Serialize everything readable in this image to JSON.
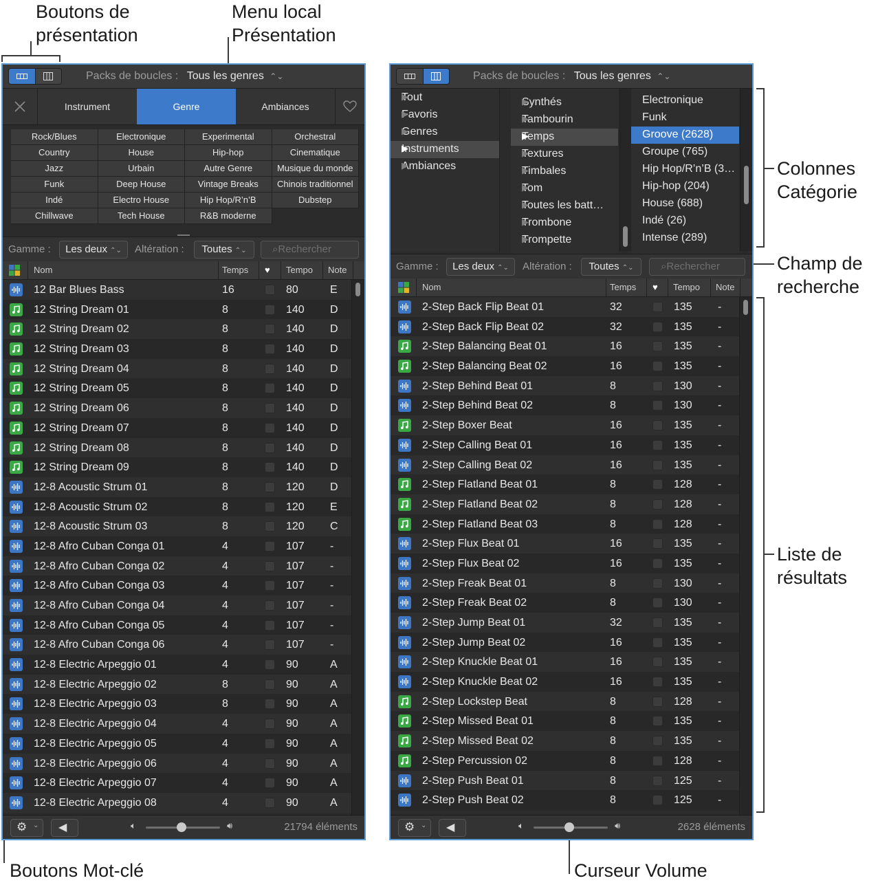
{
  "callouts": {
    "view_buttons": [
      "Boutons de",
      "présentation"
    ],
    "view_menu": [
      "Menu local",
      "Présentation"
    ],
    "category_columns": [
      "Colonnes",
      "Catégorie"
    ],
    "search_field": [
      "Champ de",
      "recherche"
    ],
    "results_list": [
      "Liste de",
      "résultats"
    ],
    "keyword_buttons": "Boutons Mot-clé",
    "volume_slider": "Curseur Volume"
  },
  "header": {
    "packs_label": "Packs de boucles :",
    "packs_value": "Tous les genres"
  },
  "left": {
    "tabs": [
      "Instrument",
      "Genre",
      "Ambiances"
    ],
    "keywords": [
      "Rock/Blues",
      "Electronique",
      "Experimental",
      "Orchestral",
      "Country",
      "House",
      "Hip-hop",
      "Cinematique",
      "Jazz",
      "Urbain",
      "Autre Genre",
      "Musique du monde",
      "Funk",
      "Deep House",
      "Vintage Breaks",
      "Chinois traditionnel",
      "Indé",
      "Electro House",
      "Hip Hop/R’n’B",
      "Dubstep",
      "Chillwave",
      "Tech House",
      "R&B moderne"
    ],
    "count": "21794 éléments",
    "rows": [
      [
        "a",
        "12 Bar Blues Bass",
        "16",
        "80",
        "E"
      ],
      [
        "m",
        "12 String Dream 01",
        "8",
        "140",
        "D"
      ],
      [
        "m",
        "12 String Dream 02",
        "8",
        "140",
        "D"
      ],
      [
        "m",
        "12 String Dream 03",
        "8",
        "140",
        "D"
      ],
      [
        "m",
        "12 String Dream 04",
        "8",
        "140",
        "D"
      ],
      [
        "m",
        "12 String Dream 05",
        "8",
        "140",
        "D"
      ],
      [
        "m",
        "12 String Dream 06",
        "8",
        "140",
        "D"
      ],
      [
        "m",
        "12 String Dream 07",
        "8",
        "140",
        "D"
      ],
      [
        "m",
        "12 String Dream 08",
        "8",
        "140",
        "D"
      ],
      [
        "m",
        "12 String Dream 09",
        "8",
        "140",
        "D"
      ],
      [
        "a",
        "12-8 Acoustic Strum 01",
        "8",
        "120",
        "D"
      ],
      [
        "a",
        "12-8 Acoustic Strum 02",
        "8",
        "120",
        "E"
      ],
      [
        "a",
        "12-8 Acoustic Strum 03",
        "8",
        "120",
        "C"
      ],
      [
        "a",
        "12-8 Afro Cuban Conga 01",
        "4",
        "107",
        "-"
      ],
      [
        "a",
        "12-8 Afro Cuban Conga 02",
        "4",
        "107",
        "-"
      ],
      [
        "a",
        "12-8 Afro Cuban Conga 03",
        "4",
        "107",
        "-"
      ],
      [
        "a",
        "12-8 Afro Cuban Conga 04",
        "4",
        "107",
        "-"
      ],
      [
        "a",
        "12-8 Afro Cuban Conga 05",
        "4",
        "107",
        "-"
      ],
      [
        "a",
        "12-8 Afro Cuban Conga 06",
        "4",
        "107",
        "-"
      ],
      [
        "a",
        "12-8 Electric Arpeggio 01",
        "4",
        "90",
        "A"
      ],
      [
        "a",
        "12-8 Electric Arpeggio 02",
        "8",
        "90",
        "A"
      ],
      [
        "a",
        "12-8 Electric Arpeggio 03",
        "8",
        "90",
        "A"
      ],
      [
        "a",
        "12-8 Electric Arpeggio 04",
        "4",
        "90",
        "A"
      ],
      [
        "a",
        "12-8 Electric Arpeggio 05",
        "4",
        "90",
        "A"
      ],
      [
        "a",
        "12-8 Electric Arpeggio 06",
        "4",
        "90",
        "A"
      ],
      [
        "a",
        "12-8 Electric Arpeggio 07",
        "4",
        "90",
        "A"
      ],
      [
        "a",
        "12-8 Electric Arpeggio 08",
        "4",
        "90",
        "A"
      ]
    ]
  },
  "filters": {
    "scale_label": "Gamme :",
    "scale_value": "Les deux",
    "sig_label": "Altération :",
    "sig_value": "Toutes",
    "search_placeholder": "Rechercher"
  },
  "columns": {
    "name": "Nom",
    "beats": "Temps",
    "tempo": "Tempo",
    "key": "Note"
  },
  "right": {
    "col1": [
      "Tout",
      "Favoris",
      "Genres",
      "Instruments",
      "Ambiances"
    ],
    "col2": [
      "Synthés",
      "Tambourin",
      "Temps",
      "Textures",
      "Timbales",
      "Tom",
      "Toutes les batt…",
      "Trombone",
      "Trompette"
    ],
    "col3": [
      "Electronique",
      "Funk",
      "Groove (2628)",
      "Groupe (765)",
      "Hip Hop/R’n’B (3…",
      "Hip-hop (204)",
      "House (688)",
      "Indé (26)",
      "Intense (289)"
    ],
    "count": "2628 éléments",
    "rows": [
      [
        "a",
        "2-Step Back Flip Beat 01",
        "32",
        "135",
        "-"
      ],
      [
        "a",
        "2-Step Back Flip Beat 02",
        "32",
        "135",
        "-"
      ],
      [
        "m",
        "2-Step Balancing Beat 01",
        "16",
        "135",
        "-"
      ],
      [
        "m",
        "2-Step Balancing Beat 02",
        "16",
        "135",
        "-"
      ],
      [
        "a",
        "2-Step Behind Beat 01",
        "8",
        "130",
        "-"
      ],
      [
        "a",
        "2-Step Behind Beat 02",
        "8",
        "130",
        "-"
      ],
      [
        "m",
        "2-Step Boxer Beat",
        "16",
        "135",
        "-"
      ],
      [
        "a",
        "2-Step Calling Beat 01",
        "16",
        "135",
        "-"
      ],
      [
        "a",
        "2-Step Calling Beat 02",
        "16",
        "135",
        "-"
      ],
      [
        "m",
        "2-Step Flatland Beat 01",
        "8",
        "128",
        "-"
      ],
      [
        "m",
        "2-Step Flatland Beat 02",
        "8",
        "128",
        "-"
      ],
      [
        "m",
        "2-Step Flatland Beat 03",
        "8",
        "128",
        "-"
      ],
      [
        "a",
        "2-Step Flux Beat 01",
        "16",
        "135",
        "-"
      ],
      [
        "a",
        "2-Step Flux Beat 02",
        "16",
        "135",
        "-"
      ],
      [
        "a",
        "2-Step Freak Beat 01",
        "8",
        "130",
        "-"
      ],
      [
        "a",
        "2-Step Freak Beat 02",
        "8",
        "130",
        "-"
      ],
      [
        "a",
        "2-Step Jump Beat 01",
        "32",
        "135",
        "-"
      ],
      [
        "a",
        "2-Step Jump Beat 02",
        "16",
        "135",
        "-"
      ],
      [
        "a",
        "2-Step Knuckle Beat 01",
        "16",
        "135",
        "-"
      ],
      [
        "a",
        "2-Step Knuckle Beat 02",
        "16",
        "135",
        "-"
      ],
      [
        "m",
        "2-Step Lockstep Beat",
        "8",
        "128",
        "-"
      ],
      [
        "m",
        "2-Step Missed Beat 01",
        "8",
        "135",
        "-"
      ],
      [
        "m",
        "2-Step Missed Beat 02",
        "8",
        "135",
        "-"
      ],
      [
        "m",
        "2-Step Percussion 02",
        "8",
        "128",
        "-"
      ],
      [
        "a",
        "2-Step Push Beat 01",
        "8",
        "125",
        "-"
      ],
      [
        "a",
        "2-Step Push Beat 02",
        "8",
        "125",
        "-"
      ]
    ]
  },
  "colors": {
    "accent": "#3d7ac9",
    "audio_icon": "#3c76c4",
    "midi_icon": "#39a845",
    "panel_border": "#5b9bd5"
  },
  "icons": [
    "grid-view-icon",
    "column-view-icon",
    "chevron-updown-icon",
    "close-icon",
    "heart-icon",
    "search-icon",
    "gear-icon",
    "speaker-icon",
    "volume-low-icon",
    "volume-high-icon",
    "audio-loop-icon",
    "midi-loop-icon",
    "color-grid-icon",
    "chevron-right-icon"
  ]
}
